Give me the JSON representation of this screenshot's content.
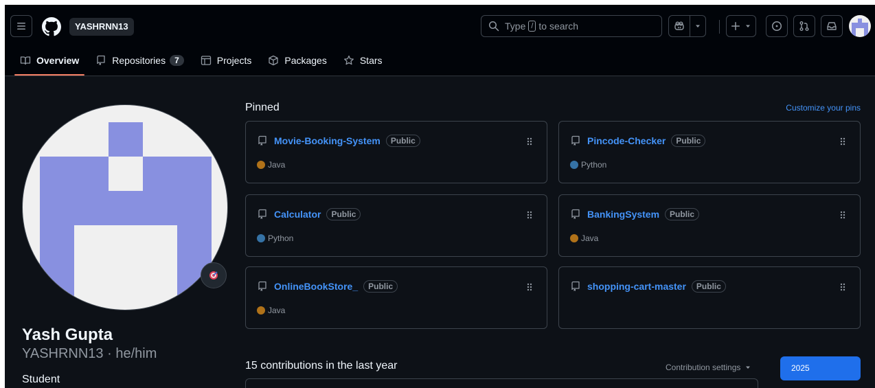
{
  "header": {
    "context_label": "YASHRNN13",
    "search": {
      "prefix": "Type",
      "key": "/",
      "suffix": "to search"
    }
  },
  "tabs": [
    {
      "label": "Overview",
      "active": true,
      "icon": "book-icon"
    },
    {
      "label": "Repositories",
      "counter": "7",
      "icon": "repo-icon"
    },
    {
      "label": "Projects",
      "icon": "table-icon"
    },
    {
      "label": "Packages",
      "icon": "package-icon"
    },
    {
      "label": "Stars",
      "icon": "star-icon"
    }
  ],
  "profile": {
    "name": "Yash Gupta",
    "login": "YASHRNN13",
    "pronouns": "he/him",
    "login_line": "YASHRNN13 · he/him",
    "bio": "Student"
  },
  "pinned": {
    "title": "Pinned",
    "customize_label": "Customize your pins",
    "repos": [
      {
        "name": "Movie-Booking-System",
        "visibility": "Public",
        "language": "Java",
        "lang_color": "#b07219"
      },
      {
        "name": "Pincode-Checker",
        "visibility": "Public",
        "language": "Python",
        "lang_color": "#3572A5"
      },
      {
        "name": "Calculator",
        "visibility": "Public",
        "language": "Python",
        "lang_color": "#3572A5"
      },
      {
        "name": "BankingSystem",
        "visibility": "Public",
        "language": "Java",
        "lang_color": "#b07219"
      },
      {
        "name": "OnlineBookStore_",
        "visibility": "Public",
        "language": "Java",
        "lang_color": "#b07219"
      },
      {
        "name": "shopping-cart-master",
        "visibility": "Public",
        "language": "",
        "lang_color": ""
      }
    ]
  },
  "contributions": {
    "title": "15 contributions in the last year",
    "settings_label": "Contribution settings",
    "year": "2025"
  },
  "colors": {
    "background": "#0d1117",
    "header": "#010409",
    "link": "#4493f8",
    "accent_tab": "#f78166",
    "primary_button": "#1f6feb",
    "identicon": "#8890e0"
  }
}
